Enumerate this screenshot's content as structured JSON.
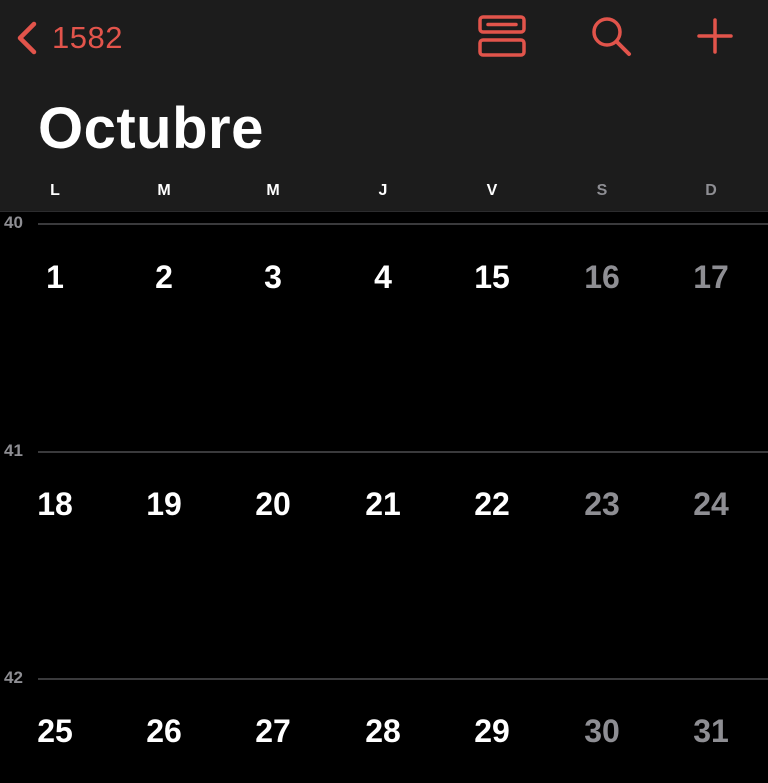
{
  "nav": {
    "back_label": "1582"
  },
  "icons": {
    "back": "chevron-left-icon",
    "list_view": "list-view-icon",
    "search": "search-icon",
    "add": "plus-icon"
  },
  "colors": {
    "accent": "#e2544b",
    "background": "#000000",
    "header_background": "#1c1c1c",
    "weekday_text": "#ffffff",
    "weekend_text": "#8e8e93",
    "divider": "#3a3a3c"
  },
  "month": {
    "title": "Octubre"
  },
  "weekdays": [
    "L",
    "M",
    "M",
    "J",
    "V",
    "S",
    "D"
  ],
  "weeks": [
    {
      "number": "40",
      "days": [
        "1",
        "2",
        "3",
        "4",
        "15",
        "16",
        "17"
      ]
    },
    {
      "number": "41",
      "days": [
        "18",
        "19",
        "20",
        "21",
        "22",
        "23",
        "24"
      ]
    },
    {
      "number": "42",
      "days": [
        "25",
        "26",
        "27",
        "28",
        "29",
        "30",
        "31"
      ]
    }
  ]
}
